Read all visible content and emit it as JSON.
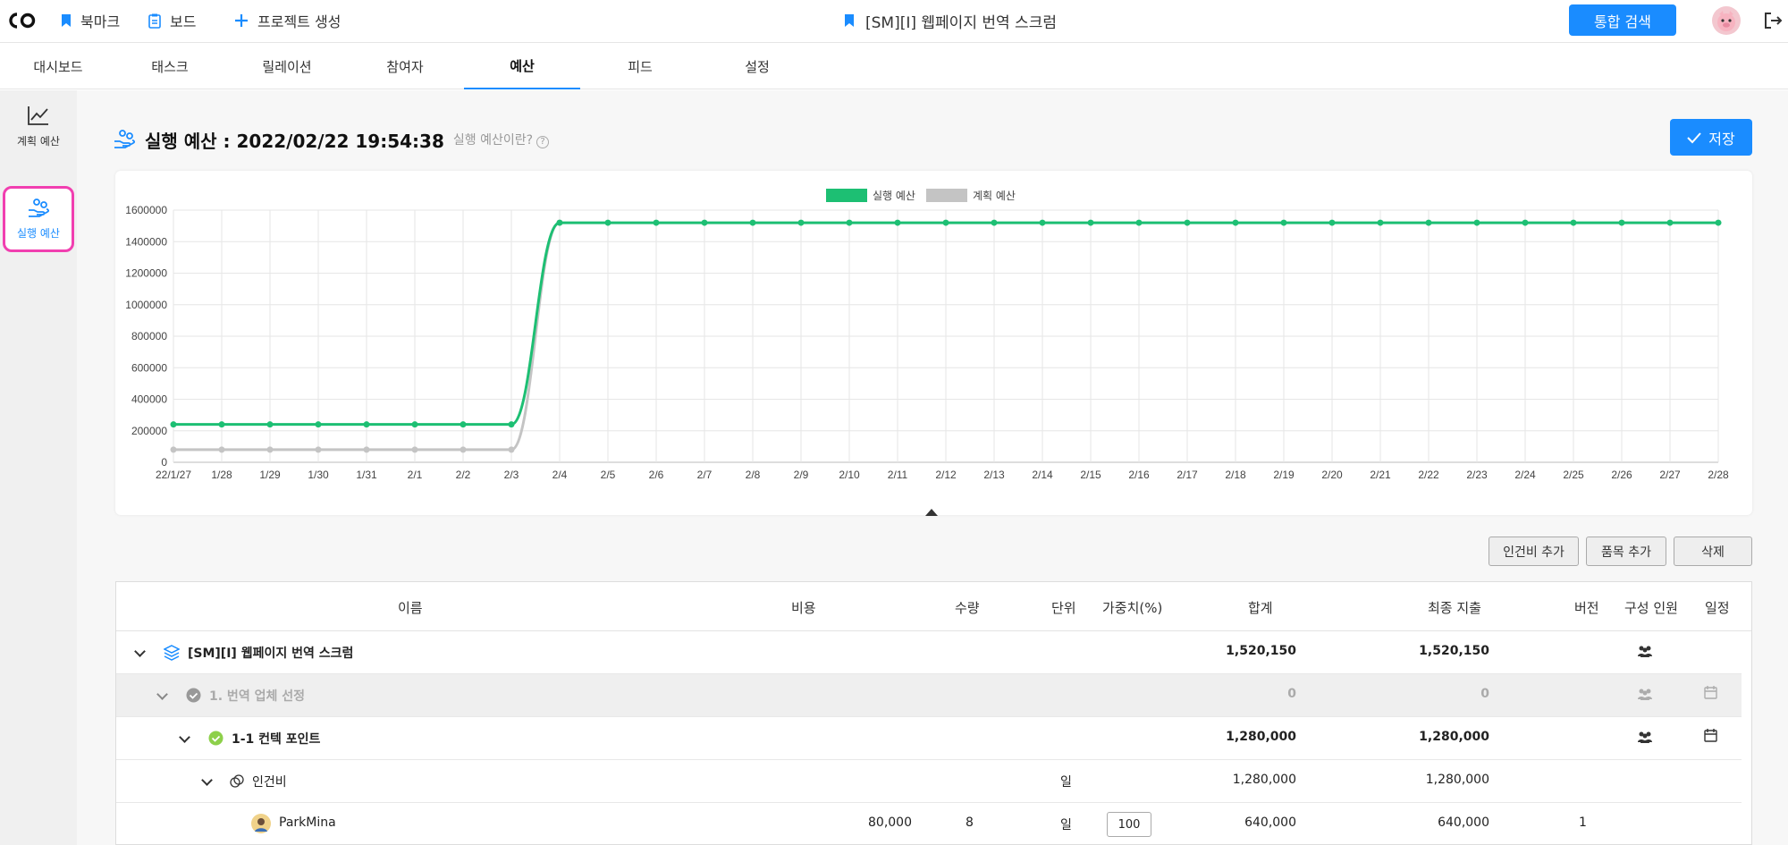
{
  "topbar": {
    "bookmark_label": "북마크",
    "board_label": "보드",
    "create_project_label": "프로젝트 생성",
    "project_title": "[SM][I] 웹페이지 번역 스크럼",
    "search_label": "통합 검색"
  },
  "tabs": [
    "대시보드",
    "태스크",
    "릴레이션",
    "참여자",
    "예산",
    "피드",
    "설정"
  ],
  "active_tab": "예산",
  "sidebar": {
    "items": [
      {
        "label": "계획 예산",
        "icon": "line-chart-icon"
      },
      {
        "label": "실행 예산",
        "icon": "hand-coins-icon"
      }
    ],
    "active": "실행 예산"
  },
  "page": {
    "title": "실행 예산 : 2022/02/22 19:54:38",
    "help_text": "실행 예산이란?",
    "help_mark": "?",
    "save_label": "저장"
  },
  "chart_data": {
    "type": "line",
    "legend": [
      "실행 예산",
      "계획 예산"
    ],
    "legend_position": "top-center",
    "grid": true,
    "ylim": [
      0,
      1600000
    ],
    "yticks": [
      "1600000",
      "1400000",
      "1200000",
      "1000000",
      "800000",
      "600000",
      "400000",
      "200000",
      "0"
    ],
    "x": [
      "22/1/27",
      "1/28",
      "1/29",
      "1/30",
      "1/31",
      "2/1",
      "2/2",
      "2/3",
      "2/4",
      "2/5",
      "2/6",
      "2/7",
      "2/8",
      "2/9",
      "2/10",
      "2/11",
      "2/12",
      "2/13",
      "2/14",
      "2/15",
      "2/16",
      "2/17",
      "2/18",
      "2/19",
      "2/20",
      "2/21",
      "2/22",
      "2/23",
      "2/24",
      "2/25",
      "2/26",
      "2/27",
      "2/28"
    ],
    "series": [
      {
        "name": "실행 예산",
        "color": "#1dbf73",
        "values": [
          240150,
          240150,
          240150,
          240150,
          240150,
          240150,
          240150,
          240150,
          1520150,
          1520150,
          1520150,
          1520150,
          1520150,
          1520150,
          1520150,
          1520150,
          1520150,
          1520150,
          1520150,
          1520150,
          1520150,
          1520150,
          1520150,
          1520150,
          1520150,
          1520150,
          1520150,
          1520150,
          1520150,
          1520150,
          1520150,
          1520150,
          1520150
        ]
      },
      {
        "name": "계획 예산",
        "color": "#c4c4c4",
        "values": [
          80000,
          80000,
          80000,
          80000,
          80000,
          80000,
          80000,
          80000,
          1520150,
          null,
          null,
          null,
          null,
          null,
          null,
          null,
          null,
          null,
          null,
          null,
          null,
          null,
          null,
          null,
          null,
          null,
          null,
          null,
          null,
          null,
          null,
          null,
          null
        ]
      }
    ]
  },
  "actions": {
    "add_labor": "인건비 추가",
    "add_item": "품목 추가",
    "delete": "삭제"
  },
  "table": {
    "headers": [
      "이름",
      "비용",
      "수량",
      "단위",
      "가중치(%)",
      "합계",
      "최종 지출",
      "버전",
      "구성 인원",
      "일정"
    ],
    "rows": [
      {
        "name": "[SM][I] 웹페이지 번역 스크럼",
        "total": "1,520,150",
        "final": "1,520,150"
      },
      {
        "name": "1. 번역 업체 선정",
        "total": "0",
        "final": "0"
      },
      {
        "name": "1-1 컨텍 포인트",
        "total": "1,280,000",
        "final": "1,280,000"
      },
      {
        "name": "인건비",
        "unit": "일",
        "total": "1,280,000",
        "final": "1,280,000"
      },
      {
        "name": "ParkMina",
        "cost": "80,000",
        "qty": "8",
        "unit": "일",
        "weight": "100",
        "total": "640,000",
        "final": "640,000",
        "version": "1"
      }
    ]
  }
}
